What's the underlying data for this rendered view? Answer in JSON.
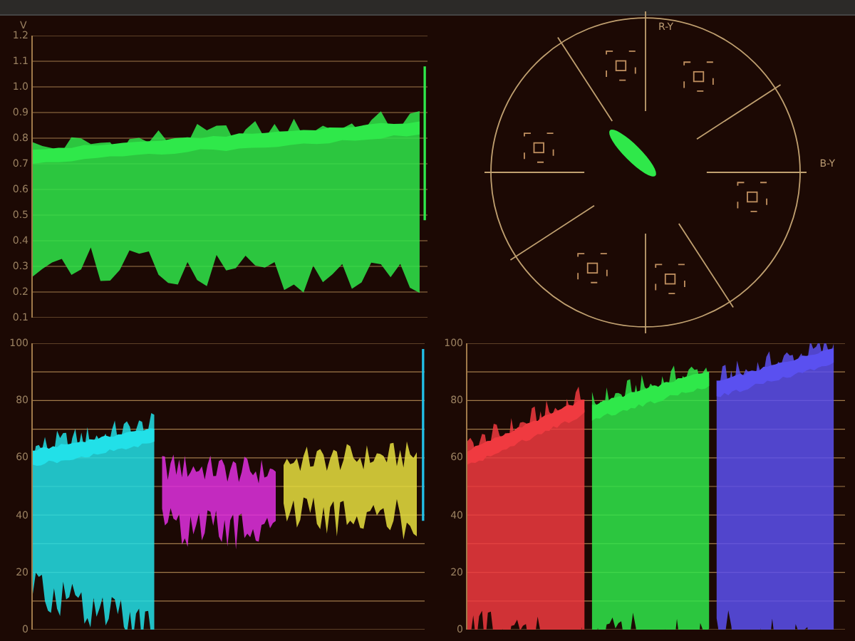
{
  "luma_waveform": {
    "axis_label": "V",
    "ticks": [
      "1.2",
      "1.1",
      "1.0",
      "0.9",
      "0.8",
      "0.7",
      "0.6",
      "0.5",
      "0.4",
      "0.3",
      "0.2",
      "0.1"
    ]
  },
  "vectorscope": {
    "vertical_axis_label": "R-Y",
    "horizontal_axis_label": "B-Y"
  },
  "ycbcr_parade": {
    "ticks": [
      "100",
      "80",
      "60",
      "40",
      "20",
      "0"
    ]
  },
  "rgb_parade": {
    "ticks": [
      "100",
      "80",
      "60",
      "40",
      "20",
      "0"
    ]
  }
}
